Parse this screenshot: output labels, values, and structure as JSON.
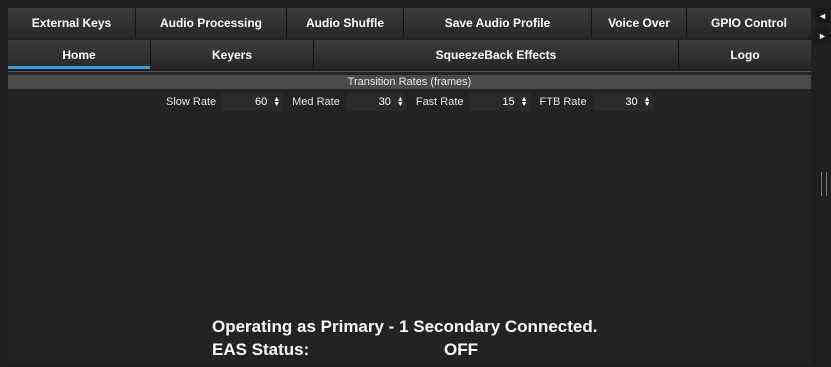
{
  "tabs_top": [
    {
      "label": "External Keys"
    },
    {
      "label": "Audio Processing"
    },
    {
      "label": "Audio Shuffle"
    },
    {
      "label": "Save Audio Profile"
    },
    {
      "label": "Voice Over"
    },
    {
      "label": "GPIO Control"
    }
  ],
  "tabs_second": [
    {
      "label": "Home",
      "active": true
    },
    {
      "label": "Keyers"
    },
    {
      "label": "SqueezeBack Effects"
    },
    {
      "label": "Logo"
    }
  ],
  "scroll": {
    "left_icon": "◄",
    "right_icon": "►"
  },
  "section": {
    "title": "Transition Rates (frames)"
  },
  "rates": [
    {
      "label": "Slow Rate",
      "value": "60"
    },
    {
      "label": "Med Rate",
      "value": "30"
    },
    {
      "label": "Fast Rate",
      "value": "15"
    },
    {
      "label": "FTB Rate",
      "value": "30"
    }
  ],
  "spin_icon": {
    "up": "▲",
    "down": "▼"
  },
  "status": {
    "operating": "Operating as Primary - 1 Secondary Connected.",
    "eas_label": "EAS Status:",
    "eas_value": "OFF"
  },
  "colors": {
    "accent": "#39a0d8",
    "background": "#1f1f1f",
    "header": "#4b4b4b"
  }
}
